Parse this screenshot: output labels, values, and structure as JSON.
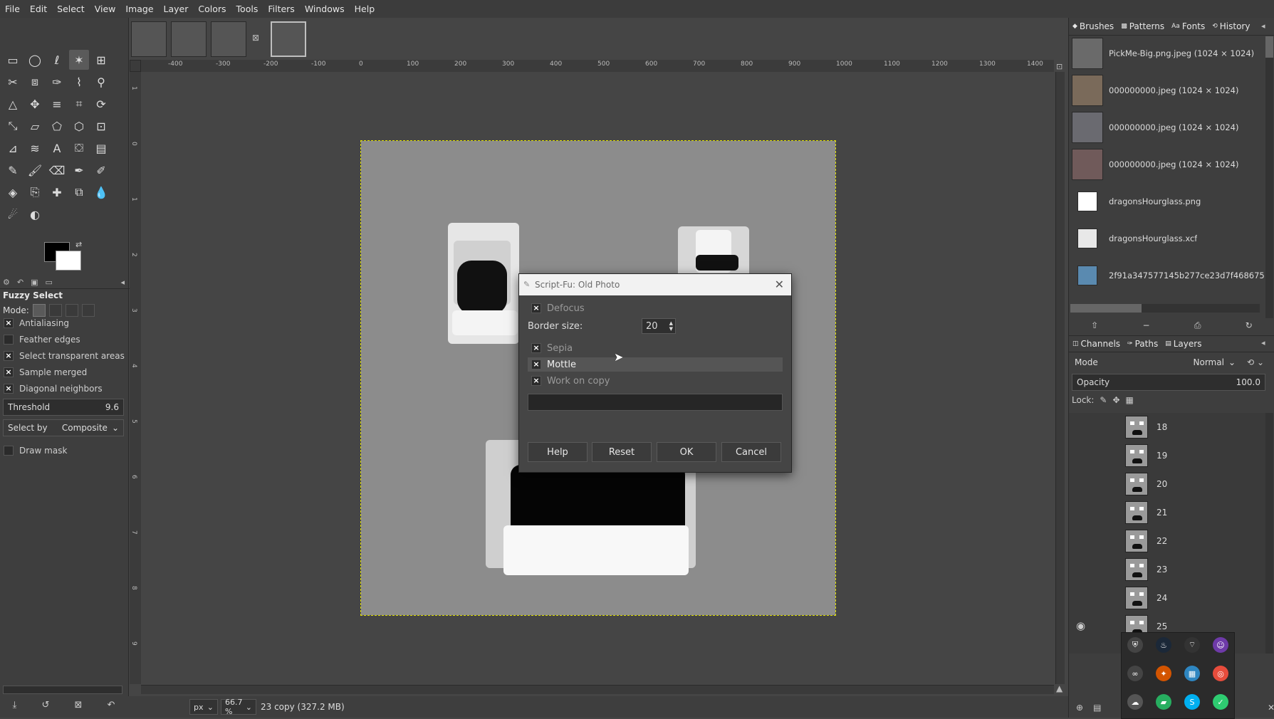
{
  "menu": [
    "File",
    "Edit",
    "Select",
    "View",
    "Image",
    "Layer",
    "Colors",
    "Tools",
    "Filters",
    "Windows",
    "Help"
  ],
  "tool_options": {
    "title": "Fuzzy Select",
    "mode_label": "Mode:",
    "antialiasing": "Antialiasing",
    "feather_edges": "Feather edges",
    "select_transparent": "Select transparent areas",
    "sample_merged": "Sample merged",
    "diagonal_neighbors": "Diagonal neighbors",
    "threshold_label": "Threshold",
    "threshold_value": "9.6",
    "select_by_label": "Select by",
    "select_by_value": "Composite",
    "draw_mask": "Draw mask"
  },
  "ruler_h": [
    "-400",
    "-300",
    "-200",
    "-100",
    "0",
    "100",
    "200",
    "300",
    "400",
    "500",
    "600",
    "700",
    "800",
    "900",
    "1000",
    "1100",
    "1200",
    "1300",
    "1400"
  ],
  "ruler_v": [
    "1",
    "0",
    "1",
    "2",
    "3",
    "4",
    "5",
    "6",
    "7",
    "8",
    "9"
  ],
  "dialog": {
    "title": "Script-Fu: Old Photo",
    "defocus": "Defocus",
    "border_label": "Border size:",
    "border_value": "20",
    "sepia": "Sepia",
    "mottle": "Mottle",
    "work_on_copy": "Work on copy",
    "help": "Help",
    "reset": "Reset",
    "ok": "OK",
    "cancel": "Cancel"
  },
  "dock_top_tabs": [
    "Brushes",
    "Patterns",
    "Fonts",
    "History"
  ],
  "history": [
    "PickMe-Big.png.jpeg (1024 × 1024)",
    "000000000.jpeg (1024 × 1024)",
    "000000000.jpeg (1024 × 1024)",
    "000000000.jpeg (1024 × 1024)",
    "dragonsHourglass.png",
    "dragonsHourglass.xcf",
    "2f91a347577145b277ce23d7f468675"
  ],
  "dock_bottom_tabs": [
    "Channels",
    "Paths",
    "Layers"
  ],
  "layers_panel": {
    "mode_label": "Mode",
    "mode_value": "Normal",
    "opacity_label": "Opacity",
    "opacity_value": "100.0",
    "lock_label": "Lock:"
  },
  "layers": [
    "18",
    "19",
    "20",
    "21",
    "22",
    "23",
    "24",
    "25"
  ],
  "status": {
    "unit": "px",
    "zoom": "66.7 %",
    "info": "23 copy (327.2 MB)"
  },
  "colors": {
    "accent_selection": "#e0e000",
    "fg_color": "#000000",
    "bg_color": "#ffffff"
  }
}
